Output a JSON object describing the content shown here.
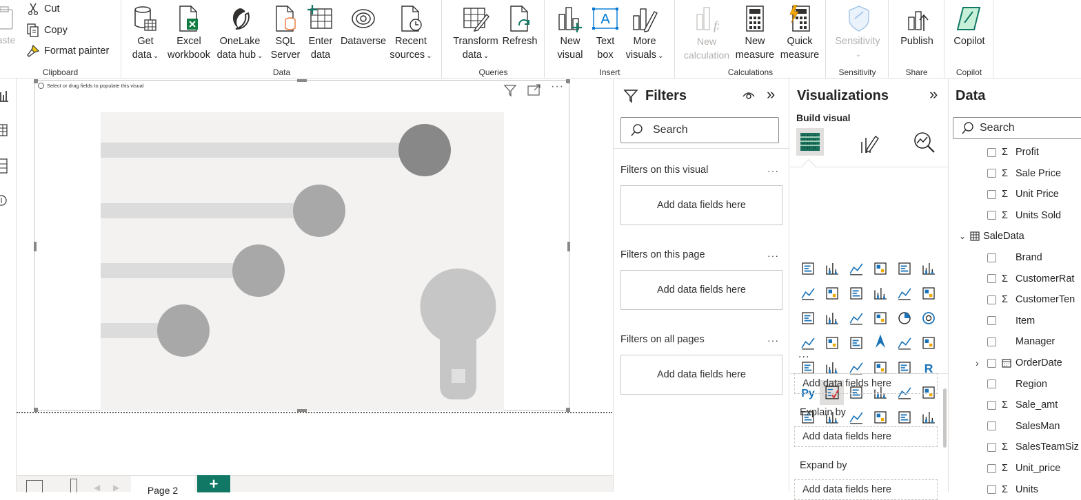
{
  "ribbon": {
    "clipboard": {
      "paste": "aste",
      "cut": "Cut",
      "copy": "Copy",
      "format_painter": "Format painter",
      "group": "Clipboard"
    },
    "data": {
      "get_data": "Get",
      "get_data2": "data",
      "excel": "Excel",
      "excel2": "workbook",
      "onelake": "OneLake",
      "onelake2": "data hub",
      "sql": "SQL",
      "sql2": "Server",
      "enter": "Enter",
      "enter2": "data",
      "dataverse": "Dataverse",
      "recent": "Recent",
      "recent2": "sources",
      "group": "Data"
    },
    "queries": {
      "transform": "Transform",
      "transform2": "data",
      "refresh": "Refresh",
      "group": "Queries"
    },
    "insert": {
      "new_visual": "New",
      "new_visual2": "visual",
      "text_box": "Text",
      "text_box2": "box",
      "more": "More",
      "more2": "visuals",
      "group": "Insert"
    },
    "calculations": {
      "new_calc": "New",
      "new_calc2": "calculation",
      "new_measure": "New",
      "new_measure2": "measure",
      "quick": "Quick",
      "quick2": "measure",
      "group": "Calculations"
    },
    "sensitivity": {
      "label": "Sensitivity",
      "group": "Sensitivity"
    },
    "share": {
      "publish": "Publish",
      "group": "Share"
    },
    "copilot": {
      "label": "Copilot",
      "group": "Copilot"
    }
  },
  "visual": {
    "hint": "Select or drag fields to populate this visual"
  },
  "pages": {
    "current": "Page 2",
    "add": "+"
  },
  "filters": {
    "title": "Filters",
    "search": "Search",
    "sections": [
      {
        "label": "Filters on this visual",
        "drop": "Add data fields here"
      },
      {
        "label": "Filters on this page",
        "drop": "Add data fields here"
      },
      {
        "label": "Filters on all pages",
        "drop": "Add data fields here"
      }
    ]
  },
  "visualizations": {
    "title": "Visualizations",
    "build": "Build visual",
    "more": "...",
    "wells": [
      {
        "label": "",
        "drop": "Add data fields here"
      },
      {
        "label": "Explain by",
        "drop": "Add data fields here"
      },
      {
        "label": "Expand by",
        "drop": "Add data fields here"
      }
    ]
  },
  "data": {
    "title": "Data",
    "search": "Search",
    "fields": [
      {
        "name": "Profit",
        "sigma": true,
        "indent": 1
      },
      {
        "name": "Sale Price",
        "sigma": true,
        "indent": 1
      },
      {
        "name": "Unit Price",
        "sigma": true,
        "indent": 1
      },
      {
        "name": "Units Sold",
        "sigma": true,
        "indent": 1
      },
      {
        "name": "SaleData",
        "table": true,
        "indent": 0
      },
      {
        "name": "Brand",
        "sigma": false,
        "indent": 1
      },
      {
        "name": "CustomerRat",
        "sigma": true,
        "indent": 1
      },
      {
        "name": "CustomerTen",
        "sigma": true,
        "indent": 1
      },
      {
        "name": "Item",
        "sigma": false,
        "indent": 1
      },
      {
        "name": "Manager",
        "sigma": false,
        "indent": 1
      },
      {
        "name": "OrderDate",
        "date": true,
        "indent": 1
      },
      {
        "name": "Region",
        "sigma": false,
        "indent": 1
      },
      {
        "name": "Sale_amt",
        "sigma": true,
        "indent": 1
      },
      {
        "name": "SalesMan",
        "sigma": false,
        "indent": 1
      },
      {
        "name": "SalesTeamSiz",
        "sigma": true,
        "indent": 1
      },
      {
        "name": "Unit_price",
        "sigma": true,
        "indent": 1
      },
      {
        "name": "Units",
        "sigma": true,
        "indent": 1
      }
    ]
  },
  "colors": {
    "accent": "#117865",
    "excel": "#107c41",
    "disabled": "#b3b0ad"
  }
}
